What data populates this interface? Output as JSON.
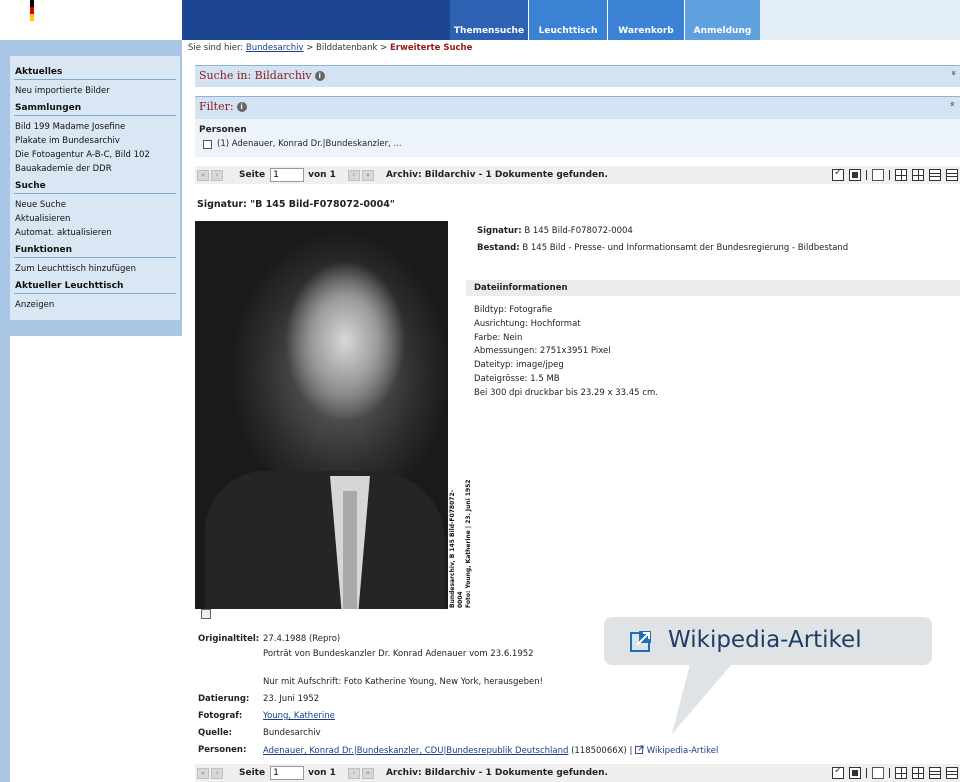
{
  "header": {
    "tabs": [
      {
        "label": "Themensuche",
        "color": "#2d62b3"
      },
      {
        "label": "Leuchttisch",
        "color": "#3b82d4"
      },
      {
        "label": "Warenkorb",
        "color": "#3b82d4"
      },
      {
        "label": "Anmeldung",
        "color": "#5fa0df"
      }
    ]
  },
  "breadcrumb": {
    "prefix": "Sie sind hier:",
    "link": "Bundesarchiv",
    "sep1": ">",
    "middle": "Bilddatenbank",
    "sep2": ">",
    "current": "Erweiterte Suche"
  },
  "sidebar": {
    "sections": [
      {
        "heading": "Aktuelles",
        "items": [
          "Neu importierte Bilder"
        ]
      },
      {
        "heading": "Sammlungen",
        "items": [
          "Bild 199 Madame Josefine",
          "Plakate im Bundesarchiv",
          "Die Fotoagentur A-B-C, Bild 102",
          "Bauakademie der DDR"
        ]
      },
      {
        "heading": "Suche",
        "items": [
          "Neue Suche",
          "Aktualisieren",
          "Automat. aktualisieren"
        ]
      },
      {
        "heading": "Funktionen",
        "items": [
          "Zum Leuchttisch hinzufügen"
        ]
      },
      {
        "heading": "Aktueller Leuchttisch",
        "items": [
          "Anzeigen"
        ]
      }
    ]
  },
  "search_bar": {
    "title": "Suche in: Bildarchiv",
    "chevron": "»"
  },
  "filter_bar": {
    "title": "Filter:",
    "chevron": "»",
    "group_label": "Personen",
    "option": "(1) Adenauer, Konrad Dr.|Bundeskanzler, ..."
  },
  "pager": {
    "first": "«",
    "prev": "‹",
    "next": "›",
    "last": "»",
    "seite_label": "Seite",
    "page_value": "1",
    "von_label": "von 1",
    "status": "Archiv: Bildarchiv - 1 Dokumente gefunden."
  },
  "record": {
    "signatur_heading": "Signatur: \"B 145 Bild-F078072-0004\"",
    "signatur_label": "Signatur:",
    "signatur_value": "B 145 Bild-F078072-0004",
    "bestand_label": "Bestand:",
    "bestand_value": "B 145 Bild - Presse- und Informationsamt der Bundesregierung - Bildbestand",
    "photo_caption_1": "Bundesarchiv, B 145 Bild-F078072-0004",
    "photo_caption_2": "Foto: Young, Katherine | 23. Juni 1952",
    "dateiinfo_heading": "Dateiinformationen",
    "dateiinfo": [
      "Bildtyp: Fotografie",
      "Ausrichtung: Hochformat",
      "Farbe: Nein",
      "Abmessungen: 2751x3951 Pixel",
      "Dateityp: image/jpeg",
      "Dateigrösse: 1.5 MB",
      "Bei 300 dpi druckbar bis 23.29 x 33.45 cm."
    ],
    "originaltitel_label": "Originaltitel:",
    "originaltitel_1": "27.4.1988 (Repro)",
    "originaltitel_2": "Porträt von Bundeskanzler Dr. Konrad Adenauer vom 23.6.1952",
    "originaltitel_3": "Nur mit Aufschrift: Foto Katherine Young, New York, herausgeben!",
    "datierung_label": "Datierung:",
    "datierung_value": "23. Juni 1952",
    "fotograf_label": "Fotograf:",
    "fotograf_value": "Young, Katherine",
    "quelle_label": "Quelle:",
    "quelle_value": "Bundesarchiv",
    "personen_label": "Personen:",
    "personen_link": "Adenauer, Konrad Dr.|Bundeskanzler, CDU|Bundesrepublik Deutschland",
    "personen_id": "(11850066X) |",
    "personen_wiki": "Wikipedia-Artikel"
  },
  "callout": {
    "text": "Wikipedia-Artikel",
    "icon": "external-link-icon"
  },
  "colors": {
    "header_blue": "#1d4692",
    "sidebar_bg": "#d9e6f3",
    "sidebar_frame": "#a8c6e4",
    "bar_bg": "#d3e3f2",
    "title_red": "#8e1b1b"
  }
}
